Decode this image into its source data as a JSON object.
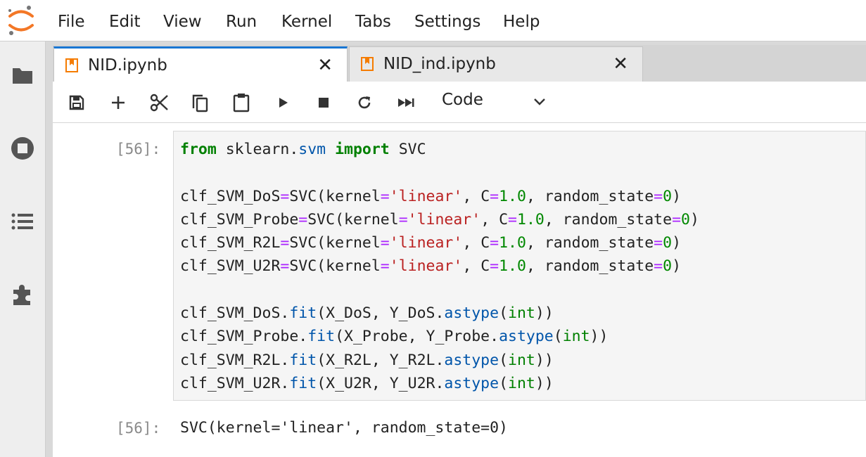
{
  "menubar": {
    "items": [
      "File",
      "Edit",
      "View",
      "Run",
      "Kernel",
      "Tabs",
      "Settings",
      "Help"
    ]
  },
  "sidebar": {
    "icons": [
      "folder-icon",
      "stop-circle-icon",
      "list-icon",
      "puzzle-icon"
    ]
  },
  "tabs": [
    {
      "label": "NID.ipynb",
      "active": true,
      "close": "✕"
    },
    {
      "label": "NID_ind.ipynb",
      "active": false,
      "close": "✕"
    }
  ],
  "toolbar": {
    "buttons": [
      "save-icon",
      "add-icon",
      "cut-icon",
      "copy-icon",
      "paste-icon",
      "run-icon",
      "stop-icon",
      "restart-icon",
      "run-all-icon"
    ],
    "cell_type": "Code"
  },
  "cells": {
    "input_prompt": "[56]:",
    "output_prompt": "[56]:",
    "code_lines": [
      "from sklearn.svm import SVC",
      "",
      "clf_SVM_DoS=SVC(kernel='linear', C=1.0, random_state=0)",
      "clf_SVM_Probe=SVC(kernel='linear', C=1.0, random_state=0)",
      "clf_SVM_R2L=SVC(kernel='linear', C=1.0, random_state=0)",
      "clf_SVM_U2R=SVC(kernel='linear', C=1.0, random_state=0)",
      "",
      "clf_SVM_DoS.fit(X_DoS, Y_DoS.astype(int))",
      "clf_SVM_Probe.fit(X_Probe, Y_Probe.astype(int))",
      "clf_SVM_R2L.fit(X_R2L, Y_R2L.astype(int))",
      "clf_SVM_U2R.fit(X_U2R, Y_U2R.astype(int))"
    ],
    "output_text": "SVC(kernel='linear', random_state=0)"
  },
  "colors": {
    "accent": "#1976d2",
    "notebook_icon": "#f57c00",
    "keyword": "#008000",
    "string": "#ba2121",
    "operator": "#aa22ff"
  }
}
